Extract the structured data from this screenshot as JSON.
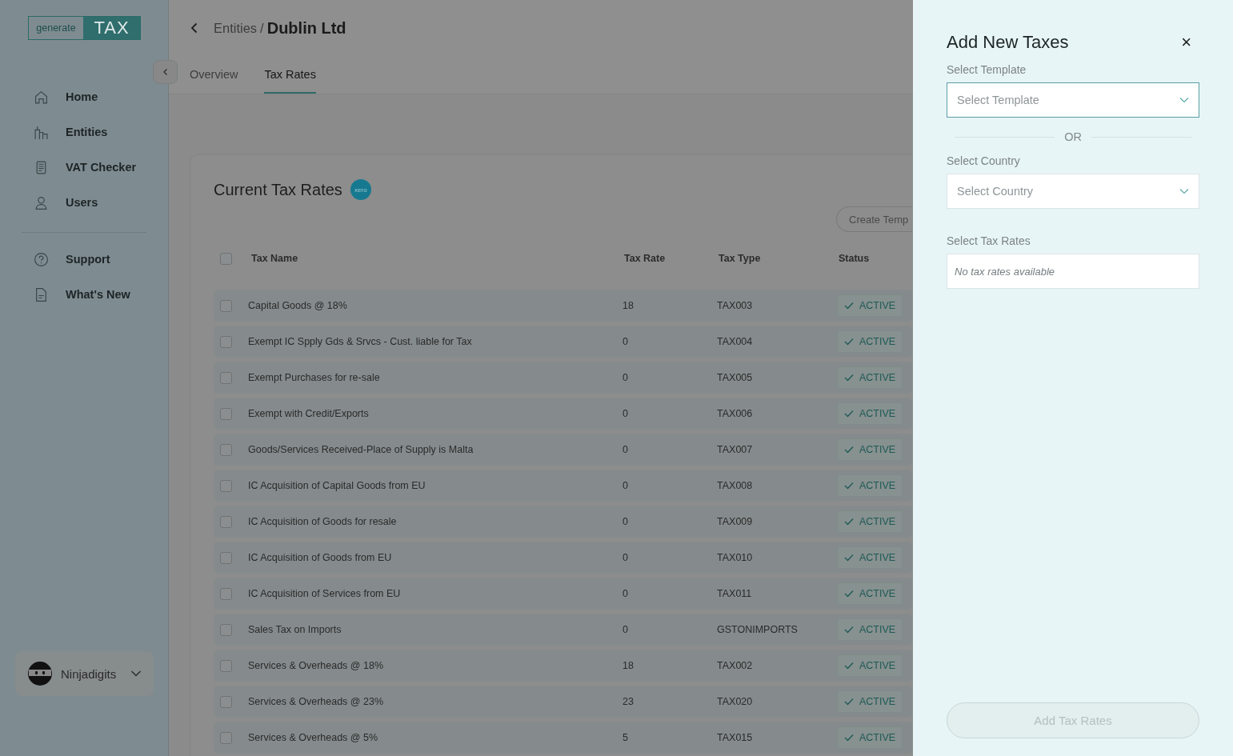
{
  "sidebar": {
    "logo": {
      "left": "generate",
      "right": "TAX"
    },
    "nav": [
      {
        "label": "Home"
      },
      {
        "label": "Entities"
      },
      {
        "label": "VAT Checker"
      },
      {
        "label": "Users"
      }
    ],
    "nav_bottom": [
      {
        "label": "Support"
      },
      {
        "label": "What's New"
      }
    ],
    "user": {
      "name": "Ninjadigits"
    }
  },
  "header": {
    "breadcrumb_parent": "Entities",
    "separator": "/",
    "title": "Dublin Ltd"
  },
  "tabs": [
    {
      "label": "Overview",
      "selected": false
    },
    {
      "label": "Tax Rates",
      "selected": true
    }
  ],
  "card": {
    "title": "Current Tax Rates",
    "badge": "xero",
    "action": "Create Temp",
    "columns": [
      "Tax Name",
      "Tax Rate",
      "Tax Type",
      "Status"
    ],
    "select_all_checked": false,
    "rows": [
      {
        "name": "Capital Goods @ 18%",
        "rate": "18",
        "type": "TAX003",
        "status": "ACTIVE",
        "checked": false
      },
      {
        "name": "Exempt IC Spply Gds & Srvcs - Cust. liable for Tax",
        "rate": "0",
        "type": "TAX004",
        "status": "ACTIVE",
        "checked": false
      },
      {
        "name": "Exempt Purchases for re-sale",
        "rate": "0",
        "type": "TAX005",
        "status": "ACTIVE",
        "checked": false
      },
      {
        "name": "Exempt with Credit/Exports",
        "rate": "0",
        "type": "TAX006",
        "status": "ACTIVE",
        "checked": false
      },
      {
        "name": "Goods/Services Received-Place of Supply is Malta",
        "rate": "0",
        "type": "TAX007",
        "status": "ACTIVE",
        "checked": false
      },
      {
        "name": "IC Acquisition of Capital Goods from EU",
        "rate": "0",
        "type": "TAX008",
        "status": "ACTIVE",
        "checked": false
      },
      {
        "name": "IC Acquisition of Goods for resale",
        "rate": "0",
        "type": "TAX009",
        "status": "ACTIVE",
        "checked": false
      },
      {
        "name": "IC Acquisition of Goods from EU",
        "rate": "0",
        "type": "TAX010",
        "status": "ACTIVE",
        "checked": false
      },
      {
        "name": "IC Acquisition of Services from EU",
        "rate": "0",
        "type": "TAX011",
        "status": "ACTIVE",
        "checked": false
      },
      {
        "name": "Sales Tax on Imports",
        "rate": "0",
        "type": "GSTONIMPORTS",
        "status": "ACTIVE",
        "checked": false
      },
      {
        "name": "Services & Overheads @ 18%",
        "rate": "18",
        "type": "TAX002",
        "status": "ACTIVE",
        "checked": false
      },
      {
        "name": "Services & Overheads @ 23%",
        "rate": "23",
        "type": "TAX020",
        "status": "ACTIVE",
        "checked": false
      },
      {
        "name": "Services & Overheads @ 5%",
        "rate": "5",
        "type": "TAX015",
        "status": "ACTIVE",
        "checked": false
      }
    ]
  },
  "drawer": {
    "title": "Add New Taxes",
    "close": "×",
    "template_label": "Select Template",
    "template_placeholder": "Select Template",
    "or": "OR",
    "country_label": "Select Country",
    "country_placeholder": "Select Country",
    "rates_label": "Select Tax Rates",
    "rates_empty": "No tax rates available",
    "submit": {
      "label": "Add Tax Rates",
      "disabled": true
    }
  }
}
